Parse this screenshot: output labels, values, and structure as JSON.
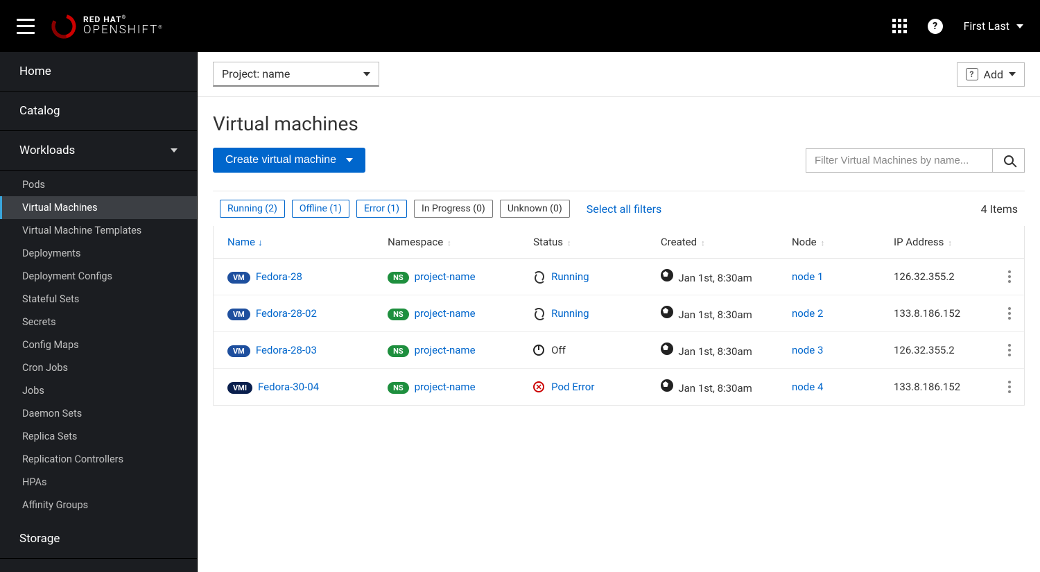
{
  "brand": {
    "line1": "RED HAT",
    "line2": "OPENSHIFT"
  },
  "user": "First Last",
  "project_selector": "Project: name",
  "add_label": "Add",
  "sidebar": {
    "primary": {
      "home": "Home",
      "catalog": "Catalog",
      "workloads": "Workloads",
      "storage": "Storage"
    },
    "workloads_items": [
      "Pods",
      "Virtual Machines",
      "Virtual Machine Templates",
      "Deployments",
      "Deployment Configs",
      "Stateful Sets",
      "Secrets",
      "Config Maps",
      "Cron Jobs",
      "Jobs",
      "Daemon Sets",
      "Replica Sets",
      "Replication Controllers",
      "HPAs",
      "Affinity Groups"
    ],
    "active_index": 1
  },
  "page": {
    "title": "Virtual machines",
    "create_label": "Create virtual machine",
    "filter_placeholder": "Filter Virtual Machines by name...",
    "select_all": "Select all filters",
    "item_count": "4 Items"
  },
  "chips": [
    {
      "label": "Running (2)",
      "active": true
    },
    {
      "label": "Offline (1)",
      "active": true
    },
    {
      "label": "Error (1)",
      "active": true
    },
    {
      "label": "In Progress (0)",
      "active": false
    },
    {
      "label": "Unknown (0)",
      "active": false
    }
  ],
  "columns": {
    "name": "Name",
    "namespace": "Namespace",
    "status": "Status",
    "created": "Created",
    "node": "Node",
    "ip": "IP Address"
  },
  "rows": [
    {
      "badge": "VM",
      "badge_kind": "vm",
      "name": "Fedora-28",
      "namespace": "project-name",
      "status_kind": "running",
      "status": "Running",
      "created": "Jan 1st, 8:30am",
      "node": "node 1",
      "ip": "126.32.355.2"
    },
    {
      "badge": "VM",
      "badge_kind": "vm",
      "name": "Fedora-28-02",
      "namespace": "project-name",
      "status_kind": "running",
      "status": "Running",
      "created": "Jan 1st, 8:30am",
      "node": "node 2",
      "ip": "133.8.186.152"
    },
    {
      "badge": "VM",
      "badge_kind": "vm",
      "name": "Fedora-28-03",
      "namespace": "project-name",
      "status_kind": "off",
      "status": "Off",
      "created": "Jan 1st, 8:30am",
      "node": "node 3",
      "ip": "126.32.355.2"
    },
    {
      "badge": "VMI",
      "badge_kind": "vmi",
      "name": "Fedora-30-04",
      "namespace": "project-name",
      "status_kind": "error",
      "status": "Pod Error",
      "created": "Jan 1st, 8:30am",
      "node": "node 4",
      "ip": "133.8.186.152"
    }
  ]
}
